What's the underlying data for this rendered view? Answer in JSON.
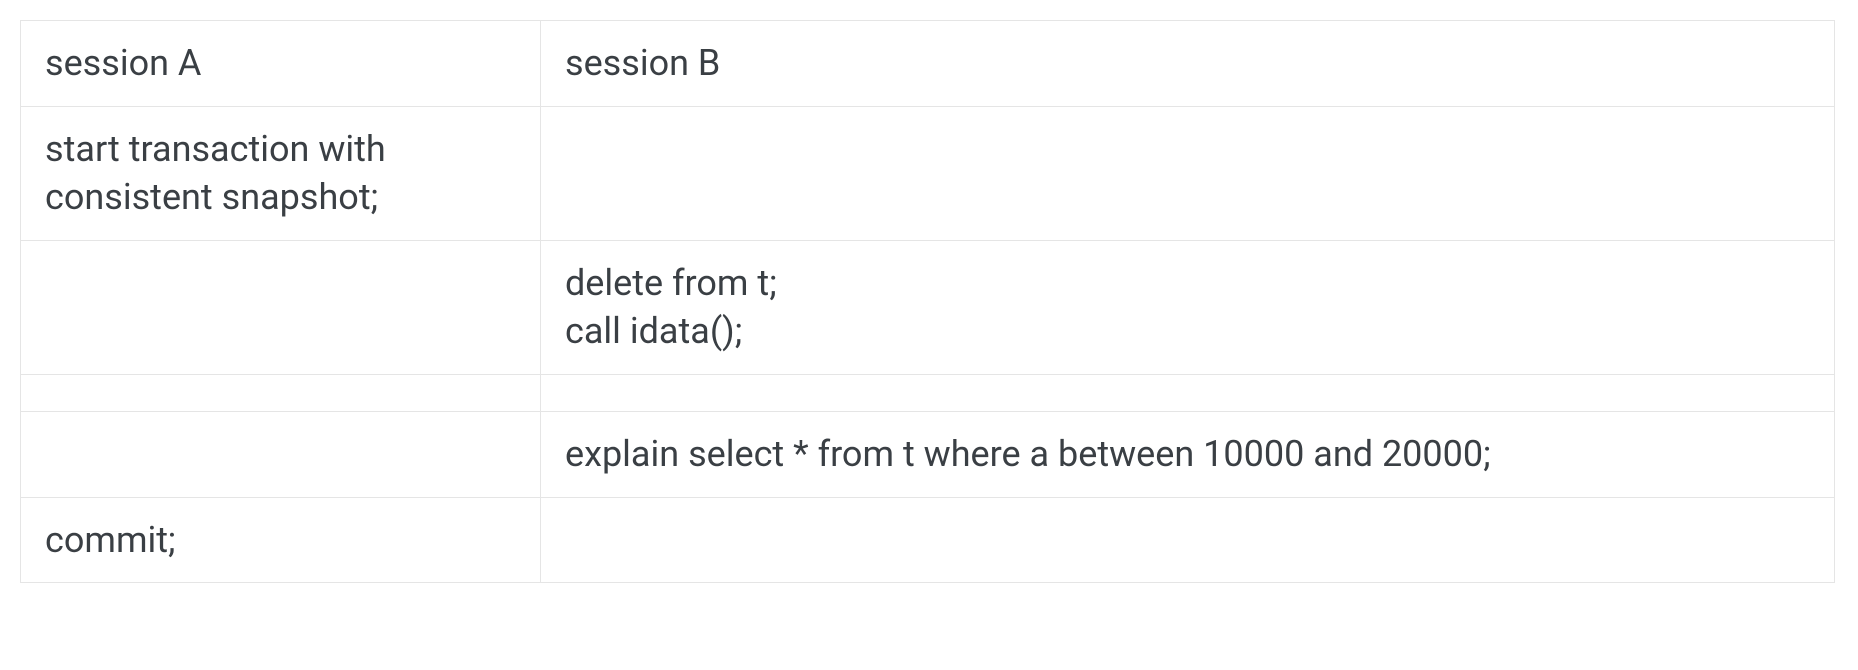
{
  "table": {
    "headers": {
      "session_a": "session A",
      "session_b": "session B"
    },
    "rows": [
      {
        "a": "start transaction with consistent snapshot;",
        "b": ""
      },
      {
        "a": "",
        "b": "delete from t;\ncall idata();"
      },
      {
        "a": "",
        "b": ""
      },
      {
        "a": "",
        "b": "explain select * from t where a between 10000 and 20000;"
      },
      {
        "a": "commit;",
        "b": ""
      }
    ]
  }
}
